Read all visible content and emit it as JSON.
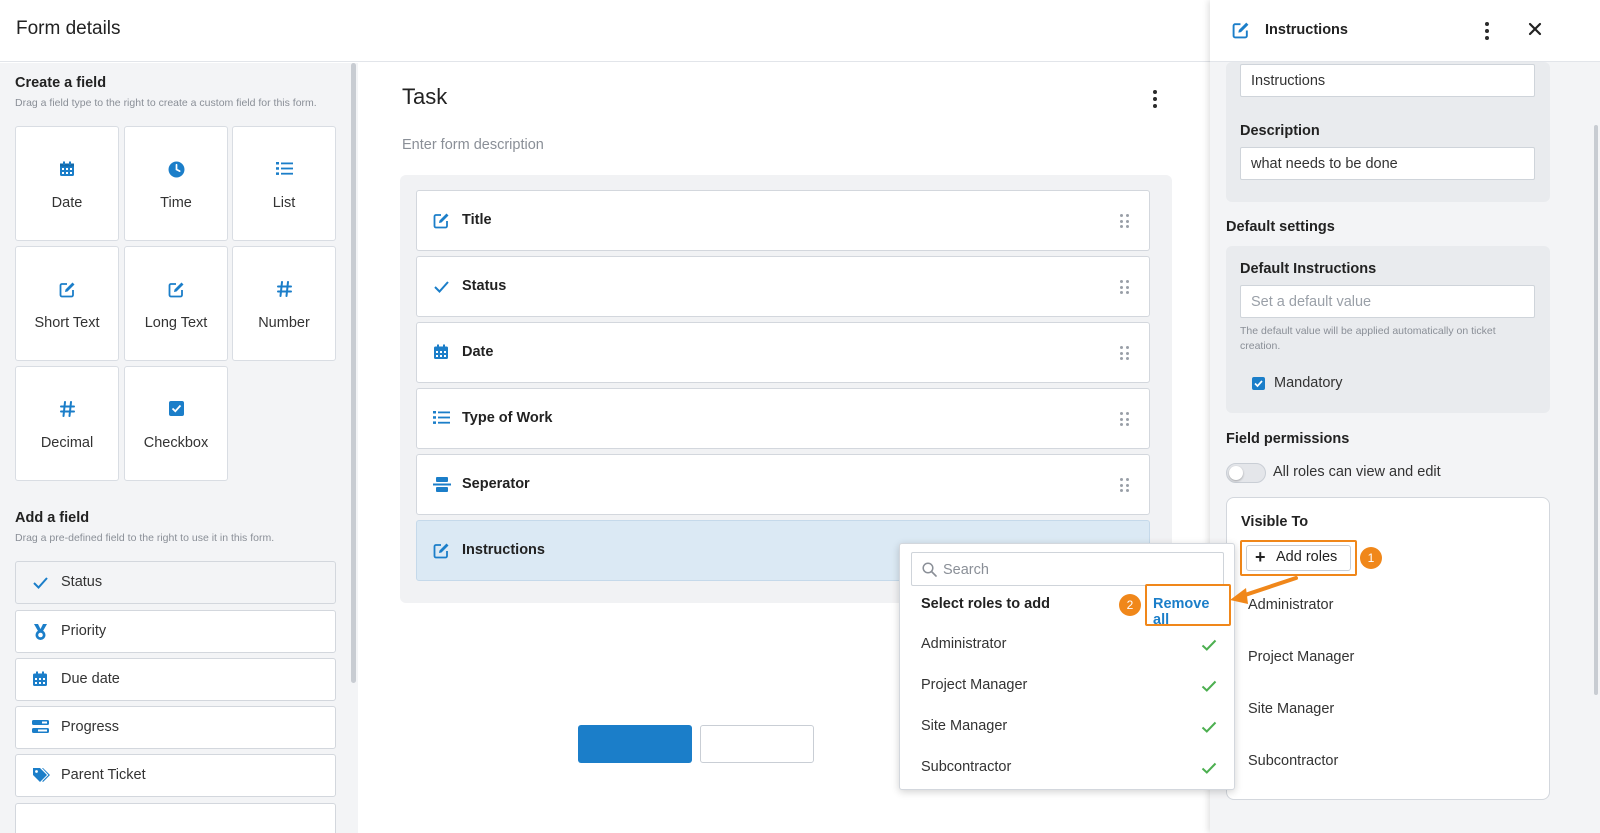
{
  "header": {
    "title": "Form details"
  },
  "left": {
    "create_title": "Create a field",
    "create_sub": "Drag a field type to the right to create a custom field for this form.",
    "tiles": [
      {
        "label": "Date",
        "icon": "calendar-icon"
      },
      {
        "label": "Time",
        "icon": "clock-icon"
      },
      {
        "label": "List",
        "icon": "list-icon"
      },
      {
        "label": "Short Text",
        "icon": "edit-icon"
      },
      {
        "label": "Long Text",
        "icon": "edit-icon"
      },
      {
        "label": "Number",
        "icon": "hash-icon"
      },
      {
        "label": "Decimal",
        "icon": "hash-icon"
      },
      {
        "label": "Checkbox",
        "icon": "checkbox-icon"
      }
    ],
    "add_title": "Add a field",
    "add_sub": "Drag a pre-defined field to the right to use it in this form.",
    "fields": [
      {
        "label": "Status",
        "icon": "check-icon"
      },
      {
        "label": "Priority",
        "icon": "medal-icon"
      },
      {
        "label": "Due date",
        "icon": "calendar-icon"
      },
      {
        "label": "Progress",
        "icon": "progress-icon"
      },
      {
        "label": "Parent Ticket",
        "icon": "tag-icon"
      }
    ]
  },
  "form": {
    "title": "Task",
    "description_placeholder": "Enter form description",
    "rows": [
      {
        "label": "Title",
        "icon": "edit-icon"
      },
      {
        "label": "Status",
        "icon": "check-icon"
      },
      {
        "label": "Date",
        "icon": "calendar-icon"
      },
      {
        "label": "Type of Work",
        "icon": "list-icon"
      },
      {
        "label": "Seperator",
        "icon": "separator-icon"
      },
      {
        "label": "Instructions",
        "icon": "edit-icon"
      }
    ]
  },
  "panel": {
    "title": "Instructions",
    "name_value": "Instructions",
    "description_label": "Description",
    "description_value": "what needs to be done",
    "default_settings": "Default settings",
    "default_label": "Default Instructions",
    "default_placeholder": "Set a default value",
    "default_hint": "The default value will be applied automatically on ticket creation.",
    "mandatory": "Mandatory",
    "permissions_title": "Field permissions",
    "toggle_label": "All roles can view and edit",
    "visible_to": "Visible To",
    "add_roles": "Add roles",
    "roles": [
      "Administrator",
      "Project Manager",
      "Site Manager",
      "Subcontractor"
    ]
  },
  "dropdown": {
    "search_placeholder": "Search",
    "heading": "Select roles to add",
    "remove_all": "Remove all",
    "items": [
      "Administrator",
      "Project Manager",
      "Site Manager",
      "Subcontractor"
    ]
  },
  "annotations": {
    "badge1": "1",
    "badge2": "2"
  },
  "colors": {
    "accent": "#1b7ec9",
    "highlight": "#f0871a",
    "check": "#4caf50",
    "selected_row": "#dbe9f4"
  }
}
